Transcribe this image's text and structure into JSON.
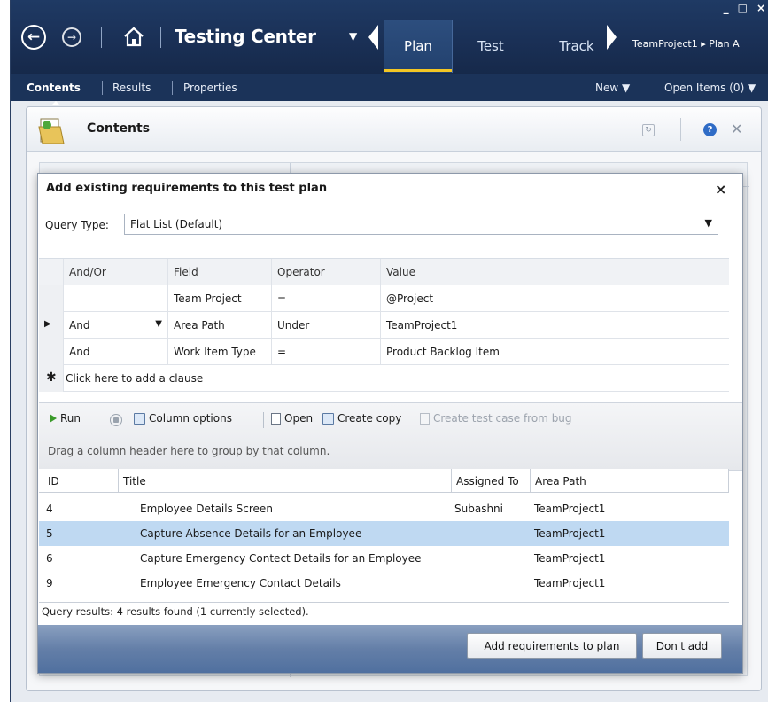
{
  "titlebar": {
    "app_title": "Testing Center",
    "tabs": [
      {
        "label": "Plan",
        "active": true
      },
      {
        "label": "Test",
        "active": false
      },
      {
        "label": "Track",
        "active": false
      }
    ],
    "project_path": "TeamProject1 ▸ Plan A",
    "window_controls": [
      "_",
      "□",
      "×"
    ]
  },
  "subnav": {
    "items": [
      "Contents",
      "Results",
      "Properties"
    ],
    "new_label": "New ▼",
    "open_items_label": "Open Items (0) ▼"
  },
  "panel": {
    "title": "Contents"
  },
  "dialog": {
    "title": "Add existing requirements to this test plan",
    "close_glyph": "×",
    "query_type_label": "Query Type:",
    "query_type_value": "Flat List (Default)",
    "clause_headers": {
      "and_or": "And/Or",
      "field": "Field",
      "operator": "Operator",
      "value": "Value"
    },
    "clauses": [
      {
        "marker": "",
        "and_or": "",
        "field": "Team Project",
        "operator": "=",
        "value": "@Project"
      },
      {
        "marker": "▶",
        "and_or": "And",
        "field": "Area Path",
        "operator": "Under",
        "value": "TeamProject1"
      },
      {
        "marker": "",
        "and_or": "And",
        "field": "Work Item Type",
        "operator": "=",
        "value": "Product Backlog Item"
      }
    ],
    "add_clause_marker": "✱",
    "add_clause_text": "Click here to add a clause",
    "toolbar": {
      "run": "Run",
      "column_options": "Column options",
      "open": "Open",
      "create_copy": "Create copy",
      "create_test_case": "Create test case from bug"
    },
    "group_hint": "Drag a column header here to group by that column.",
    "result_headers": {
      "id": "ID",
      "title": "Title",
      "assigned_to": "Assigned To",
      "area_path": "Area Path"
    },
    "results": [
      {
        "id": "4",
        "title": "Employee Details Screen",
        "assigned_to": "Subashni",
        "area_path": "TeamProject1",
        "selected": false
      },
      {
        "id": "5",
        "title": "Capture Absence Details for an Employee",
        "assigned_to": "",
        "area_path": "TeamProject1",
        "selected": true
      },
      {
        "id": "6",
        "title": "Capture Emergency Contect Details for an Employee",
        "assigned_to": "",
        "area_path": "TeamProject1",
        "selected": false
      },
      {
        "id": "9",
        "title": "Employee Emergency Contact Details",
        "assigned_to": "",
        "area_path": "TeamProject1",
        "selected": false
      }
    ],
    "status": "Query results: 4 results found (1 currently selected).",
    "buttons": {
      "add": "Add requirements to plan",
      "dont_add": "Don't add"
    }
  },
  "colors": {
    "titlebar": "#1a3056",
    "active_tab_underline": "#f3c624",
    "selected_row": "#bfd9f2",
    "dialog_footer": "#647fa8"
  }
}
